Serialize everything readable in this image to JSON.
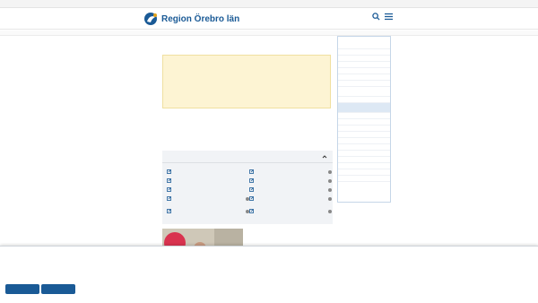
{
  "topstrip": {
    "left_text": "",
    "right_text": ""
  },
  "header": {
    "logo_text": "Region Örebro län",
    "search_label": "",
    "menu_label": ""
  },
  "breadcrumb": "",
  "main": {
    "back_link": "",
    "title": "",
    "notice": "",
    "paragraph": "",
    "signature_1": "",
    "signature_2": "",
    "services": {
      "heading": "",
      "items": [
        {
          "label": ""
        },
        {
          "label": ""
        },
        {
          "label": ""
        },
        {
          "label": ""
        },
        {
          "label": ""
        },
        {
          "label": ""
        },
        {
          "label": ""
        },
        {
          "label": ""
        },
        {
          "label": ""
        },
        {
          "label": ""
        }
      ]
    },
    "promo": {
      "title": "",
      "text": "",
      "link": "",
      "badge": ""
    }
  },
  "sidebar": {
    "heading": "",
    "items": [
      {
        "label": ""
      },
      {
        "label": ""
      },
      {
        "label": ""
      },
      {
        "label": ""
      },
      {
        "label": ""
      },
      {
        "label": ""
      },
      {
        "label": ""
      },
      {
        "label": ""
      },
      {
        "label": ""
      },
      {
        "label": ""
      },
      {
        "label": ""
      },
      {
        "label": ""
      },
      {
        "label": ""
      },
      {
        "label": ""
      },
      {
        "label": ""
      },
      {
        "label": ""
      },
      {
        "label": ""
      },
      {
        "label": ""
      },
      {
        "label": ""
      },
      {
        "label": ""
      },
      {
        "label": ""
      }
    ]
  },
  "cookie": {
    "small": "",
    "title": "",
    "text": "",
    "settings_link": "",
    "btn_necessary": "",
    "btn_accept_all": ""
  },
  "colors": {
    "brand": "#1a5a96",
    "notice_bg": "#fdf4d3",
    "services_bg": "#f1f3f6",
    "promo_badge": "#d9334f"
  },
  "icons": [
    "logo-icon",
    "search-icon",
    "menu-icon",
    "chevron-up-icon",
    "external-link-icon",
    "info-dot-icon"
  ]
}
